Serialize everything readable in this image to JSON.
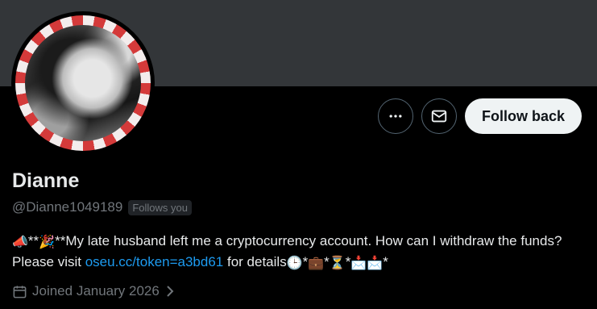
{
  "profile": {
    "name": "Dianne",
    "handle": "@Dianne1049189",
    "follows_you_badge": "Follows you",
    "bio": {
      "prefix_emoji": "📣",
      "stars1": "**",
      "party_emoji": "🎉",
      "stars2": "**",
      "text": "My late husband left me a cryptocurrency account. How can I withdraw the funds? Please visit ",
      "link": "oseu.cc/token=a3bd61",
      "suffix": "  for details",
      "clock_emoji": "🕒",
      "star1": "*",
      "briefcase_emoji": "💼",
      "star2": "*",
      "hourglass_emoji": "⏳",
      "star3": "*",
      "inbox1_emoji": "📩",
      "inbox2_emoji": "📩",
      "star4": "*"
    },
    "joined": "Joined January 2026"
  },
  "actions": {
    "follow_back_label": "Follow back"
  },
  "icons": {
    "more": "more-options-icon",
    "message": "envelope-icon",
    "calendar": "calendar-icon",
    "chevron": "chevron-right-icon"
  },
  "colors": {
    "background": "#000000",
    "banner": "#333639",
    "link": "#1d9bf0",
    "secondary_text": "#71767b",
    "button_light": "#eff3f4"
  }
}
